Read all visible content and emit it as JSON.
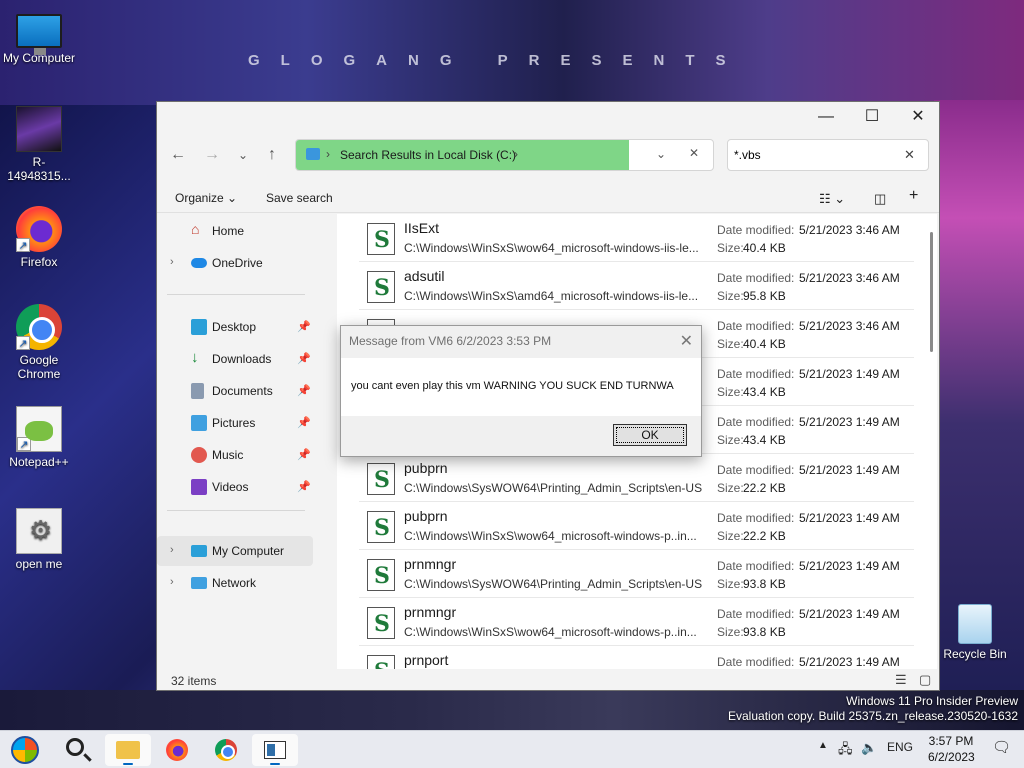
{
  "wallpaper": {
    "banner_text": "GLOGANG PRESENTS"
  },
  "desktop": {
    "icons": [
      {
        "label": "My Computer",
        "icon": "computer-icon"
      },
      {
        "label": "R-14948315...",
        "icon": "album-art-icon"
      },
      {
        "label": "Firefox",
        "icon": "firefox-icon"
      },
      {
        "label": "Google Chrome",
        "icon": "chrome-icon"
      },
      {
        "label": "Notepad++",
        "icon": "notepadpp-icon"
      },
      {
        "label": "open me",
        "icon": "gear-file-icon"
      },
      {
        "label": "Recycle Bin",
        "icon": "recycle-bin-icon"
      }
    ]
  },
  "explorer": {
    "address": {
      "segment": "Search Results in Local Disk (C:)"
    },
    "search": {
      "value": "*.vbs"
    },
    "toolbar": {
      "organize": "Organize",
      "save_search": "Save search"
    },
    "sidebar": {
      "home": "Home",
      "onedrive": "OneDrive",
      "desktop": "Desktop",
      "downloads": "Downloads",
      "documents": "Documents",
      "pictures": "Pictures",
      "music": "Music",
      "videos": "Videos",
      "my_computer": "My Computer",
      "network": "Network"
    },
    "labels": {
      "date_modified": "Date modified:",
      "size": "Size:"
    },
    "files": [
      {
        "name": "IIsExt",
        "path": "C:\\Windows\\WinSxS\\wow64_microsoft-windows-iis-le...",
        "modified": "5/21/2023 3:46 AM",
        "size": "40.4 KB"
      },
      {
        "name": "adsutil",
        "path": "C:\\Windows\\WinSxS\\amd64_microsoft-windows-iis-le...",
        "modified": "5/21/2023 3:46 AM",
        "size": "95.8 KB"
      },
      {
        "name": "",
        "path": "",
        "modified": "5/21/2023 3:46 AM",
        "size": "40.4 KB"
      },
      {
        "name": "",
        "path": "",
        "modified": "5/21/2023 1:49 AM",
        "size": "43.4 KB"
      },
      {
        "name": "",
        "path": "",
        "modified": "5/21/2023 1:49 AM",
        "size": "43.4 KB"
      },
      {
        "name": "pubprn",
        "path": "C:\\Windows\\SysWOW64\\Printing_Admin_Scripts\\en-US",
        "modified": "5/21/2023 1:49 AM",
        "size": "22.2 KB"
      },
      {
        "name": "pubprn",
        "path": "C:\\Windows\\WinSxS\\wow64_microsoft-windows-p..in...",
        "modified": "5/21/2023 1:49 AM",
        "size": "22.2 KB"
      },
      {
        "name": "prnmngr",
        "path": "C:\\Windows\\SysWOW64\\Printing_Admin_Scripts\\en-US",
        "modified": "5/21/2023 1:49 AM",
        "size": "93.8 KB"
      },
      {
        "name": "prnmngr",
        "path": "C:\\Windows\\WinSxS\\wow64_microsoft-windows-p..in...",
        "modified": "5/21/2023 1:49 AM",
        "size": "93.8 KB"
      },
      {
        "name": "prnport",
        "path": "",
        "modified": "5/21/2023 1:49 AM",
        "size": ""
      }
    ],
    "status": "32 items"
  },
  "dialog": {
    "title": "Message from VM6 6/2/2023 3:53 PM",
    "message": "you cant even play this vm WARNING YOU SUCK END TURNWA",
    "ok": "OK"
  },
  "watermark": {
    "line1": "Windows 11 Pro Insider Preview",
    "line2": "Evaluation copy. Build 25375.zn_release.230520-1632"
  },
  "taskbar": {
    "language": "ENG",
    "time": "3:57 PM",
    "date": "6/2/2023"
  }
}
